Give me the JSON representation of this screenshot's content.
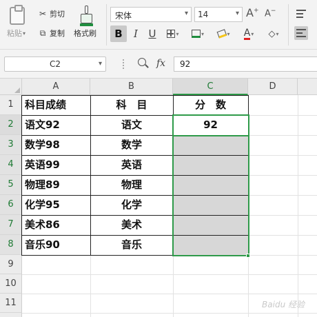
{
  "ribbon": {
    "paste_label": "粘贴",
    "cut_label": "剪切",
    "copy_label": "复制",
    "format_painter_label": "格式刷",
    "font_name": "宋体",
    "font_size": "14",
    "grow_font": "A",
    "shrink_font": "A",
    "bold": "B",
    "italic": "I",
    "underline": "U",
    "font_color": "A"
  },
  "formula_bar": {
    "name_box": "C2",
    "fx": "fx",
    "formula": "92"
  },
  "columns": [
    "A",
    "B",
    "C",
    "D"
  ],
  "rows": [
    "1",
    "2",
    "3",
    "4",
    "5",
    "6",
    "7",
    "8",
    "9",
    "10",
    "11"
  ],
  "table": {
    "headers": [
      "科目成绩",
      "科　目",
      "分　数"
    ],
    "rows": [
      {
        "a": "语文92",
        "b": "语文",
        "c": "92"
      },
      {
        "a": "数学98",
        "b": "数学",
        "c": ""
      },
      {
        "a": "英语99",
        "b": "英语",
        "c": ""
      },
      {
        "a": "物理89",
        "b": "物理",
        "c": ""
      },
      {
        "a": "化学95",
        "b": "化学",
        "c": ""
      },
      {
        "a": "美术86",
        "b": "美术",
        "c": ""
      },
      {
        "a": "音乐90",
        "b": "音乐",
        "c": ""
      }
    ]
  },
  "selection": {
    "active_cell": "C2",
    "range": "C2:C8"
  },
  "colors": {
    "selection": "#2e9a49",
    "selected_fill": "#d7d7d7",
    "font_color_bar": "#e02020",
    "fill_color_bar": "#f5c518"
  },
  "icons": [
    "paste-icon",
    "scissors-icon",
    "copy-icon",
    "format-painter-icon",
    "bold-icon",
    "italic-icon",
    "underline-icon",
    "borders-icon",
    "cell-style-icon",
    "fill-color-icon",
    "font-color-icon",
    "eraser-icon",
    "align-top-icon",
    "align-left-icon",
    "zoom-icon",
    "fx-icon"
  ]
}
